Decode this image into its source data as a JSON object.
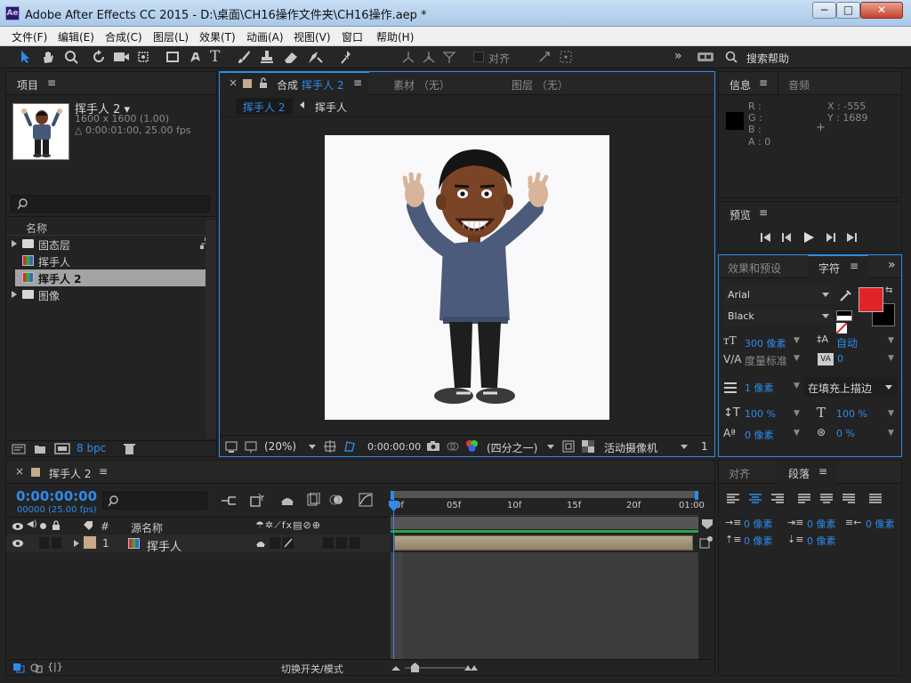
{
  "window": {
    "title": "Adobe After Effects CC 2015 - D:\\桌面\\CH16操作文件夹\\CH16操作.aep *",
    "logo": "Ae",
    "min": "−",
    "max": "□",
    "close": "✕"
  },
  "menu": [
    "文件(F)",
    "编辑(E)",
    "合成(C)",
    "图层(L)",
    "效果(T)",
    "动画(A)",
    "视图(V)",
    "窗口",
    "帮助(H)"
  ],
  "toolbar": {
    "align_label": "对齐",
    "more": "»",
    "search_help": "搜索帮助"
  },
  "project": {
    "tab": "项目",
    "selected_name": "挥手人 2 ▾",
    "selected_size": "1600 x 1600 (1.00)",
    "selected_duration": "△ 0:00:01:00, 25.00 fps",
    "column_name": "名称",
    "items": [
      {
        "label": "固态层",
        "type": "folder"
      },
      {
        "label": "挥手人",
        "type": "comp"
      },
      {
        "label": "挥手人 2",
        "type": "comp",
        "selected": true
      },
      {
        "label": "图像",
        "type": "folder"
      }
    ],
    "bpc": "8 bpc"
  },
  "viewer": {
    "tab_prefix": "合成",
    "tab_name": "挥手人 2",
    "footage_tab": "素材 （无）",
    "layer_tab": "图层 （无）",
    "breadcrumb_active": "挥手人 2",
    "breadcrumb_next": "挥手人",
    "zoom": "(20%)",
    "time": "0:00:00:00",
    "resolution": "(四分之一)",
    "camera": "活动摄像机",
    "views": "1"
  },
  "info": {
    "tab": "信息",
    "audio_tab": "音频",
    "r": "R :",
    "g": "G :",
    "b": "B :",
    "a": "A : 0",
    "x": "X : -555",
    "y": "Y : 1689"
  },
  "preview": {
    "tab": "预览"
  },
  "character": {
    "effects_tab": "效果和预设",
    "tab": "字符",
    "more": "»",
    "font": "Arial",
    "style": "Black",
    "size": "300 像素",
    "leading": "自动",
    "kerning": "度量标准",
    "tracking": "0",
    "stroke_width": "1 像素",
    "stroke_type": "在填充上描边",
    "vscale": "100 %",
    "hscale": "100 %",
    "baseline": "0 像素",
    "tsume": "0 %",
    "fill_color": "#e02428"
  },
  "paragraph": {
    "align_tab": "对齐",
    "tab": "段落",
    "indent_left": "0 像素",
    "indent_first": "0 像素",
    "indent_right": "0 像素",
    "space_before": "0 像素",
    "space_after": "0 像素"
  },
  "timeline": {
    "tab": "挥手人 2",
    "timecode": "0:00:00:00",
    "frames": "00000 (25.00 fps)",
    "col_num": "#",
    "col_source": "源名称",
    "layer_num": "1",
    "layer_name": "挥手人",
    "ruler": [
      "0f",
      "05f",
      "10f",
      "15f",
      "20f",
      "01:00"
    ],
    "toggle_label": "切换开关/模式"
  }
}
